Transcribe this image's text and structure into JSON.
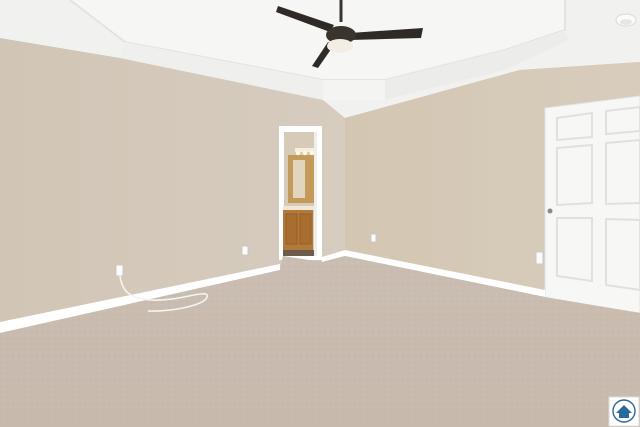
{
  "scene": {
    "kind": "empty-bedroom-interior",
    "elements": [
      "tray-ceiling",
      "ceiling-fan",
      "smoke-detector",
      "beige-walls",
      "white-baseboards",
      "open-doorway-to-bathroom",
      "bathroom-vanity",
      "closed-white-door",
      "electrical-outlets",
      "loose-cable",
      "beige-carpet",
      "watermark-logo"
    ]
  },
  "colors": {
    "wall": "#d3c8b8",
    "wall_shadow": "#c6baa9",
    "ceiling": "#f3f3f1",
    "trim": "#ffffff",
    "carpet": "#cbbfb3",
    "fan_blade": "#2f2a26",
    "vanity_wood": "#b27a3a"
  },
  "watermark": {
    "text": "",
    "icon": "house-logo-icon"
  }
}
